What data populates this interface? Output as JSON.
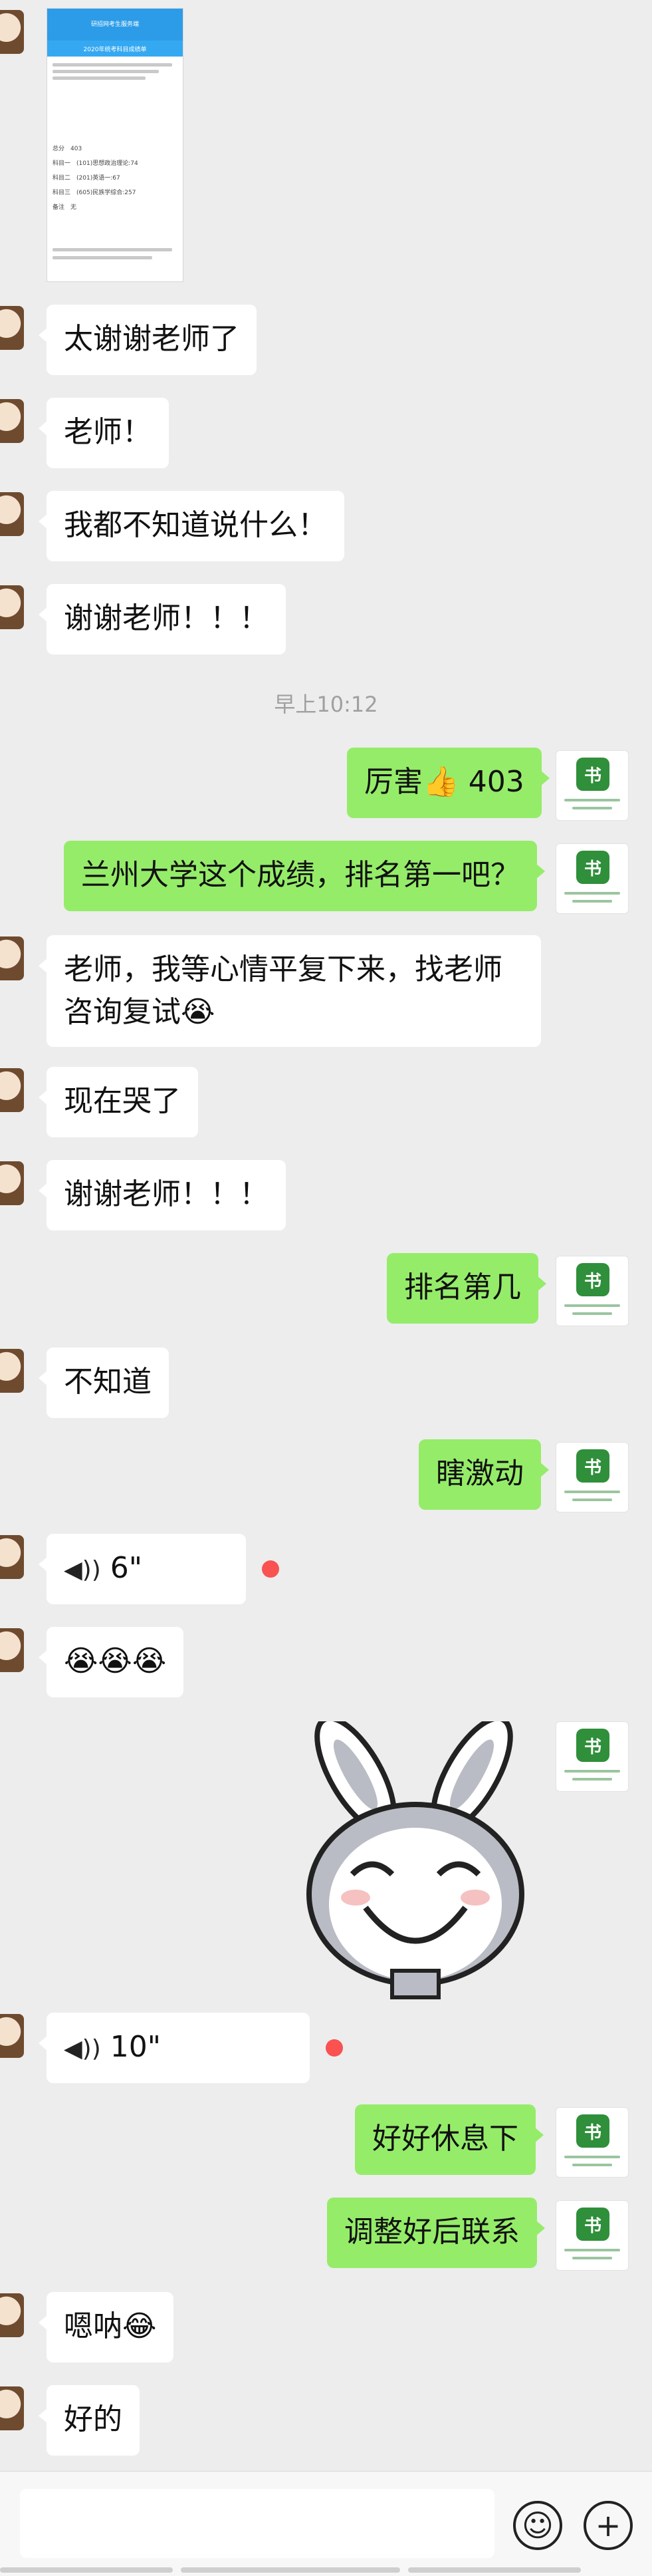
{
  "screenshot": {
    "header": "研招网考生服务端",
    "subtitle": "2020年统考科目成绩单",
    "rows": [
      {
        "label": "总分",
        "value": "403"
      },
      {
        "label": "科目一",
        "value": "(101)思想政治理论:74"
      },
      {
        "label": "科目二",
        "value": "(201)英语一:67"
      },
      {
        "label": "科目三",
        "value": "(605)民族学综合:257"
      },
      {
        "label": "备注",
        "value": "无"
      }
    ]
  },
  "messages": {
    "m1": {
      "text": "太谢谢老师了"
    },
    "m2": {
      "text": "老师！"
    },
    "m3": {
      "text": "我都不知道说什么！"
    },
    "m4": {
      "text": "谢谢老师！！！"
    },
    "time1": {
      "text": "早上10:12"
    },
    "m5": {
      "text": "厉害",
      "emoji": "👍",
      "tail": "403"
    },
    "m6": {
      "text": "兰州大学这个成绩，排名第一吧？"
    },
    "m7": {
      "line1": "老师，我等心情平复下来，找老师",
      "line2": "咨询复试",
      "emoji": "😭"
    },
    "m8": {
      "text": "现在哭了"
    },
    "m9": {
      "text": "谢谢老师！！！"
    },
    "m10": {
      "text": "排名第几"
    },
    "m11": {
      "text": "不知道"
    },
    "m12": {
      "text": "瞎激动"
    },
    "voice1": {
      "duration": "6\""
    },
    "m13": {
      "emojis": "😭😭😭"
    },
    "voice2": {
      "duration": "10\""
    },
    "m14": {
      "text": "好好休息下"
    },
    "m15": {
      "text": "调整好后联系"
    },
    "m16": {
      "text": "嗯呐",
      "emoji": "😂"
    },
    "m17": {
      "text": "好的"
    }
  },
  "icons": {
    "voice": "voice-wave-icon",
    "emoji": "smiley-icon",
    "plus": "plus-icon"
  },
  "colors": {
    "background": "#ededed",
    "bubble_out": "#95ec69",
    "bubble_in": "#ffffff",
    "unread": "#fa5151"
  }
}
